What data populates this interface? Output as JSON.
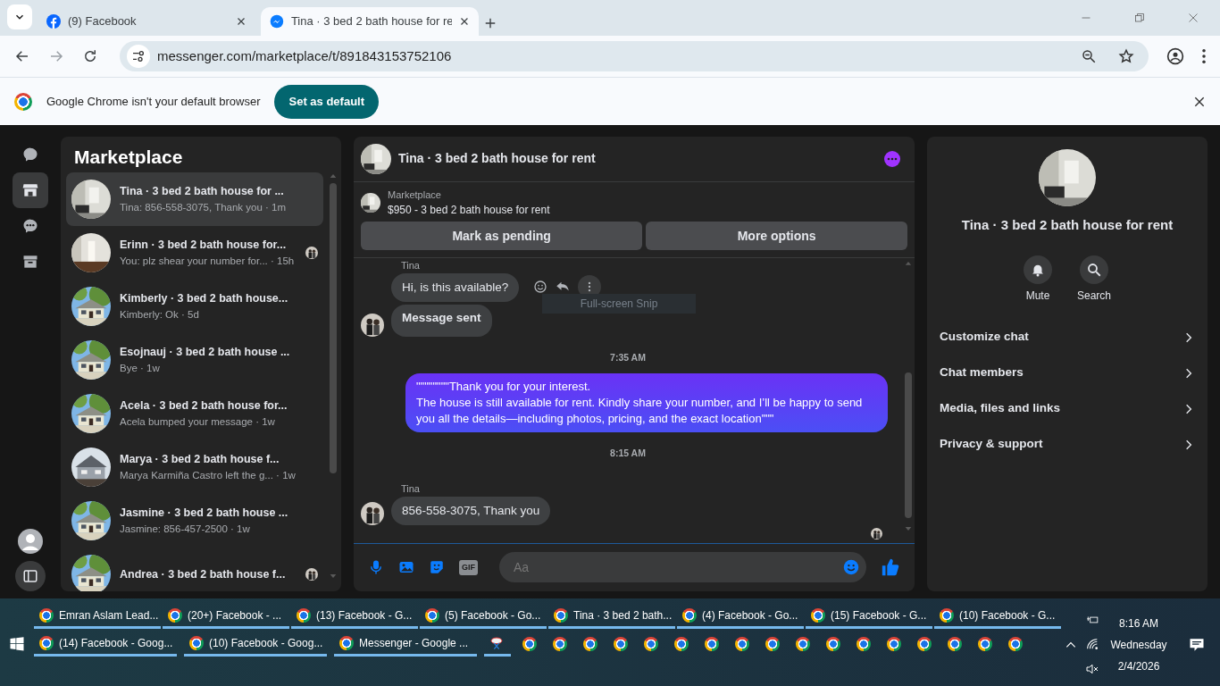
{
  "browser": {
    "tabs": [
      {
        "title": "(9) Facebook",
        "selected": false
      },
      {
        "title": "Tina · 3 bed 2 bath house for re",
        "selected": true
      }
    ],
    "url": "messenger.com/marketplace/t/891843153752106",
    "infobar": {
      "message": "Google Chrome isn't your default browser",
      "button": "Set as default"
    }
  },
  "rail": {
    "items": [
      {
        "kind": "chats",
        "selected": false
      },
      {
        "kind": "marketplace",
        "selected": true
      },
      {
        "kind": "requests",
        "selected": false
      },
      {
        "kind": "archive",
        "selected": false
      }
    ]
  },
  "conversations": {
    "title": "Marketplace",
    "items": [
      {
        "name": "Tina · 3 bed 2 bath house for ...",
        "preview": "Tina: 856-558-3075, Thank you · 1m",
        "selected": true,
        "seen": false
      },
      {
        "name": "Erinn · 3 bed 2 bath house for...",
        "preview": "You: plz shear your number for... · 15h",
        "selected": false,
        "seen": true
      },
      {
        "name": "Kimberly · 3 bed 2 bath house...",
        "preview": "Kimberly: Ok · 5d",
        "selected": false,
        "seen": false
      },
      {
        "name": "Esojnauj · 3 bed 2 bath house ...",
        "preview": "Bye · 1w",
        "selected": false,
        "seen": false
      },
      {
        "name": "Acela · 3 bed 2 bath house for...",
        "preview": "Acela bumped your message · 1w",
        "selected": false,
        "seen": false
      },
      {
        "name": "Marya · 3 bed 2 bath house f...",
        "preview": "Marya Karmiña Castro left the g... · 1w",
        "selected": false,
        "seen": false
      },
      {
        "name": "Jasmine · 3 bed 2 bath house ...",
        "preview": "Jasmine: 856-457-2500 · 1w",
        "selected": false,
        "seen": false
      },
      {
        "name": "Andrea · 3 bed 2 bath house f...",
        "selected": false,
        "seen": true
      }
    ]
  },
  "chat": {
    "title": "Tina · 3 bed 2 bath house for rent",
    "listing": {
      "source": "Marketplace",
      "title": "$950 - 3 bed 2 bath house for rent",
      "buttons": [
        "Mark as pending",
        "More options"
      ]
    },
    "messages": [
      {
        "kind": "sender",
        "text": "Tina"
      },
      {
        "kind": "incoming",
        "text": "Hi, is this available?",
        "avatar": false,
        "actions": true
      },
      {
        "kind": "notice",
        "text": "Message sent",
        "avatar": true,
        "actions": false
      },
      {
        "kind": "time",
        "text": "7:35 AM"
      },
      {
        "kind": "outgoing",
        "text": "\"\"\"\"\"\"\"\"Thank you for your interest.\nThe house is still available for rent. Kindly share your number, and I’ll be happy to send you all the details—including photos, pricing, and the exact location\"\"\""
      },
      {
        "kind": "time",
        "text": "8:15 AM"
      },
      {
        "kind": "sender",
        "text": "Tina"
      },
      {
        "kind": "incoming",
        "text": "856-558-3075, Thank you",
        "avatar": true,
        "actions": false
      }
    ],
    "seen_receipt": true,
    "tooltip": "Full-screen Snip",
    "composer": {
      "placeholder": "Aa",
      "gif": "GIF"
    }
  },
  "info": {
    "title": "Tina · 3 bed 2 bath house for rent",
    "actions": [
      "Mute",
      "Search"
    ],
    "menu": [
      "Customize chat",
      "Chat members",
      "Media, files and links",
      "Privacy & support"
    ]
  },
  "taskbar": {
    "row1": [
      "Emran Aslam Lead...",
      "(20+) Facebook - ...",
      "(13) Facebook - G...",
      "(5) Facebook - Go...",
      "Tina · 3 bed 2 bath...",
      "(4) Facebook - Go...",
      "(15) Facebook - G...",
      "(10) Facebook - G..."
    ],
    "row2": [
      "(14) Facebook - Goog...",
      "(10) Facebook - Goog...",
      "Messenger - Google ..."
    ],
    "clock": {
      "time": "8:16 AM",
      "day": "Wednesday",
      "date": "2/4/2026"
    }
  }
}
